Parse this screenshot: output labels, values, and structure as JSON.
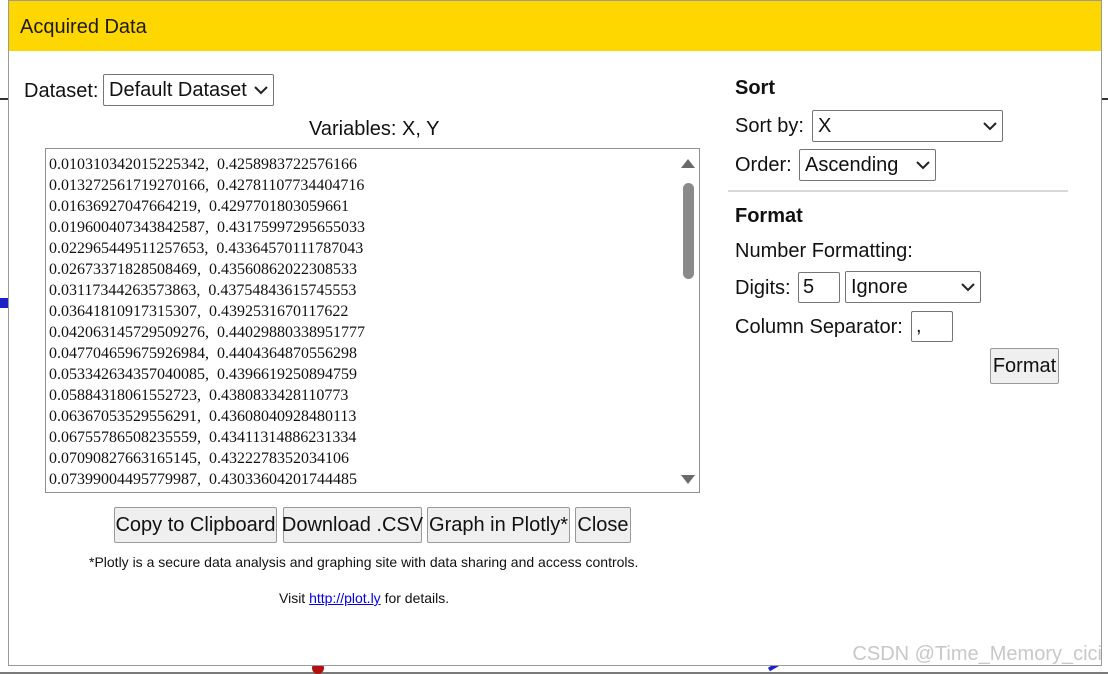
{
  "dialog": {
    "title": "Acquired Data",
    "accent_color": "#ffd700"
  },
  "dataset": {
    "label": "Dataset:",
    "selected": "Default Dataset"
  },
  "variables_text": "Variables: X, Y",
  "data_rows": [
    "0.010310342015225342,  0.4258983722576166",
    "0.013272561719270166,  0.42781107734404716",
    "0.01636927047664219,  0.4297701803059661",
    "0.019600407343842587,  0.43175997295655033",
    "0.022965449511257653,  0.43364570111787043",
    "0.02673371828508469,  0.43560862022308533",
    "0.03117344263573863,  0.43754843615745553",
    "0.03641810917315307,  0.4392531670117622",
    "0.042063145729509276,  0.44029880338951777",
    "0.047704659675926984,  0.4404364870556298",
    "0.053342634357040085,  0.4396619250894759",
    "0.05884318061552723,  0.4380833428110773",
    "0.06367053529556291,  0.43608040928480113",
    "0.06755786508235559,  0.43411314886231334",
    "0.07090827663165145,  0.4322278352034106",
    "0.07399004495779987,  0.43033604201744485"
  ],
  "buttons": {
    "copy": "Copy to Clipboard",
    "download": "Download .CSV",
    "plotly": "Graph in Plotly*",
    "close": "Close",
    "format": "Format"
  },
  "notes": {
    "plotly_disclaimer": "*Plotly is a secure data analysis and graphing site with data sharing and access controls.",
    "visit_prefix": "Visit ",
    "visit_link": "http://plot.ly",
    "visit_suffix": " for details."
  },
  "sort": {
    "heading": "Sort",
    "sort_by_label": "Sort by:",
    "sort_by_value": "X",
    "order_label": "Order:",
    "order_value": "Ascending"
  },
  "format": {
    "heading": "Format",
    "number_formatting_label": "Number Formatting:",
    "digits_label": "Digits:",
    "digits_value": "5",
    "digits_mode": "Ignore",
    "separator_label": "Column Separator:",
    "separator_value": ","
  },
  "watermark": "CSDN @Time_Memory_cici"
}
